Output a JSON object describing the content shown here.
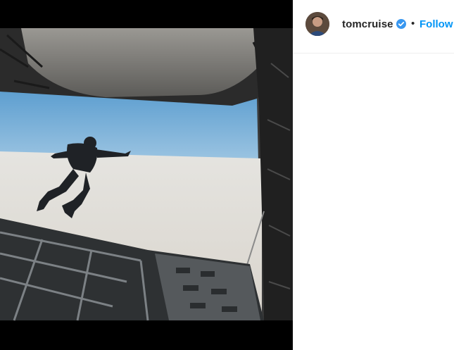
{
  "post": {
    "media": {
      "icon": "photo"
    },
    "header": {
      "username": "tomcruise",
      "verified_icon": "verified-badge-icon",
      "separator": "•",
      "follow_label": "Follow",
      "follow_color": "#0095f6"
    }
  }
}
